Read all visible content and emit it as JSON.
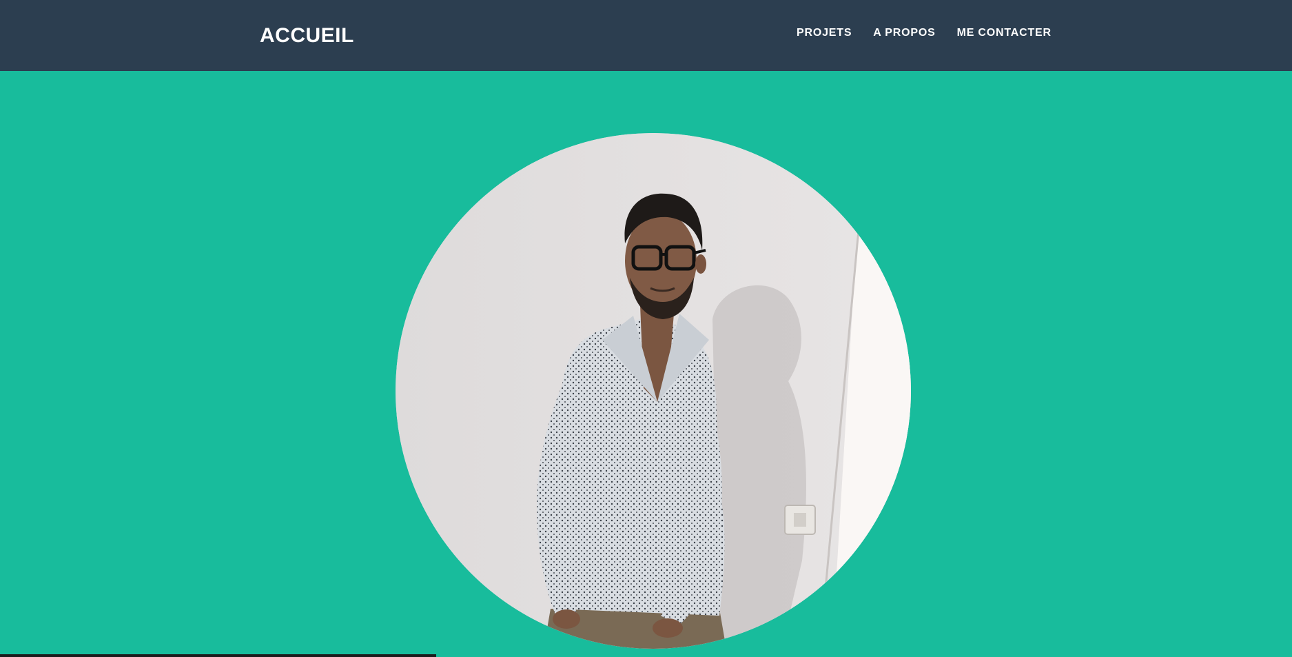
{
  "navbar": {
    "brand": "ACCUEIL",
    "links": [
      {
        "label": "PROJETS"
      },
      {
        "label": "A PROPOS"
      },
      {
        "label": "ME CONTACTER"
      }
    ]
  },
  "hero": {
    "image": "profile-photo"
  },
  "colors": {
    "navbar_bg": "#2c3e50",
    "hero_bg": "#18bc9c",
    "text": "#ffffff"
  }
}
